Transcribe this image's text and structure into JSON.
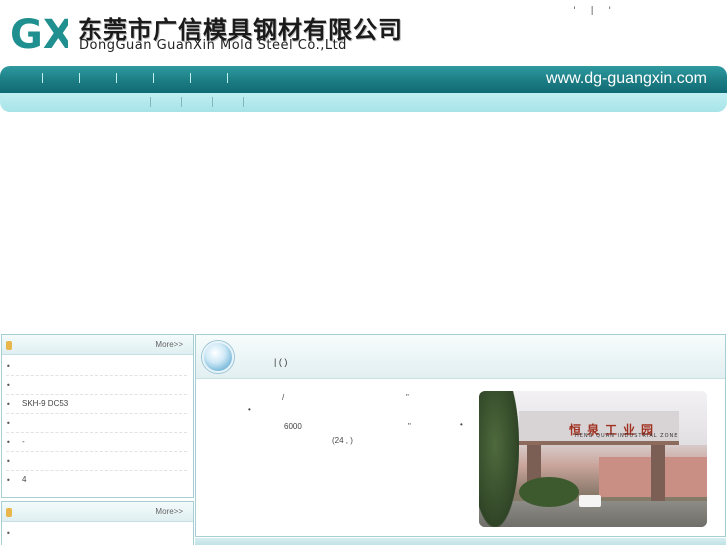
{
  "header": {
    "logo_text": "GX",
    "company_cn": "东莞市广信模具钢材有限公司",
    "company_en": "DongGuan GuanXin Mold Steel Co.,Ltd",
    "top_links": [
      "'",
      "|",
      "'"
    ]
  },
  "nav": {
    "site_url": "www.dg-guangxin.com"
  },
  "left_panels": [
    {
      "more_label": "More>>",
      "items": [
        {
          "bullet": "•",
          "text": ""
        },
        {
          "bullet": "•",
          "text": ""
        },
        {
          "bullet": "•",
          "text": "SKH-9 DC53"
        },
        {
          "bullet": "•",
          "text": ""
        },
        {
          "bullet": "•",
          "text": "-"
        },
        {
          "bullet": "•",
          "text": ""
        },
        {
          "bullet": "•",
          "text": "4"
        }
      ]
    },
    {
      "more_label": "More>>",
      "items": [
        {
          "bullet": "•",
          "text": ""
        }
      ]
    }
  ],
  "main": {
    "title": "| (          )",
    "fragments": [
      "/",
      "\"",
      "•",
      "6000",
      "\"",
      "•",
      "(24   ,   )"
    ],
    "photo": {
      "gate_cn": "恒泉工业园",
      "gate_en": "HENG QUAN INDUSTRIAL ZONE"
    }
  },
  "colors": {
    "nav_teal": "#1c7c84",
    "subbar": "#a8e3e8",
    "border": "#a7cfd3"
  }
}
